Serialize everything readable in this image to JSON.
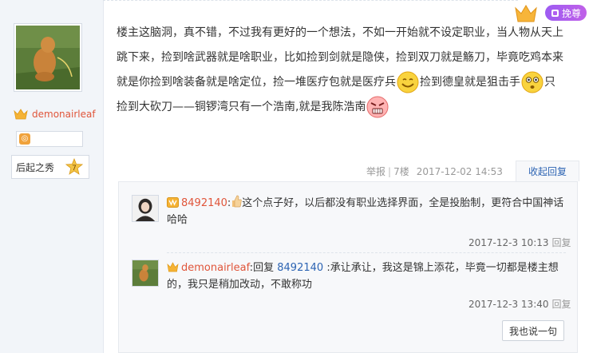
{
  "sidebar": {
    "username": "demonairleaf",
    "level_name": "后起之秀",
    "level_num": "7"
  },
  "top_badge": {
    "label": "挽尊"
  },
  "post": {
    "seg1": "楼主这脑洞，真不错，不过我有更好的一个想法，不如一开始就不设定职业，当人物从天上跳下来，捡到啥武器就是啥职业，比如捡到剑就是隐侠，捡到双刀就是觞刀，毕竟吃鸡本来就是你捡到啥装备就是啥定位，捡一堆医疗包就是医疗兵",
    "seg2": "捡到德皇就是狙击手",
    "seg3": "只捡到大砍刀——铜锣湾只有一个浩南,就是我陈浩南"
  },
  "meta": {
    "report": "举报",
    "separator": "|",
    "floor": "7楼",
    "date": "2017-12-02 14:53",
    "collapse": "收起回复"
  },
  "replies": [
    {
      "name": "8492140",
      "colon": ":",
      "text": "这个点子好，以后都没有职业选择界面，全是投胎制，更符合中国神话哈哈",
      "time": "2017-12-3 10:13",
      "reply_label": "回复"
    },
    {
      "name": "demonairleaf",
      "colon": ":",
      "prefix": "回复",
      "target": "8492140",
      "text": ":承让承让，我这是锦上添花，毕竟一切都是楼主想的，我只是稍加改动，不敢称功",
      "time": "2017-12-3 13:40",
      "reply_label": "回复"
    }
  ],
  "say_button": "我也说一句",
  "colors": {
    "username": "#e0553a",
    "link": "#2d64b3",
    "badge": "#b05ef0"
  }
}
